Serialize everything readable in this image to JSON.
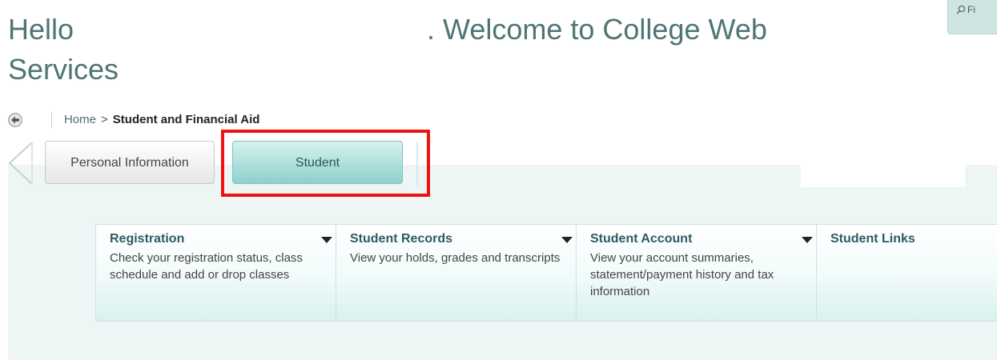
{
  "header": {
    "hello": "Hello",
    "welcome": ". Welcome to College Web",
    "services": "Services",
    "search_label": "Fi"
  },
  "breadcrumb": {
    "home": "Home",
    "separator": ">",
    "current": "Student and Financial Aid"
  },
  "tabs": [
    {
      "label": "Personal Information",
      "selected": false
    },
    {
      "label": "Student",
      "selected": true
    }
  ],
  "cards": [
    {
      "title": "Registration",
      "description": "Check your registration status, class schedule and add or drop classes",
      "has_menu": true
    },
    {
      "title": "Student Records",
      "description": "View your holds, grades and transcripts",
      "has_menu": true
    },
    {
      "title": "Student Account",
      "description": "View your account summaries, statement/payment history and tax information",
      "has_menu": true
    },
    {
      "title": "Student Links",
      "description": "",
      "has_menu": false
    }
  ],
  "colors": {
    "accent": "#4f7574",
    "selected_tab": "#8fd0cd",
    "highlight": "#ee1111",
    "panel_bg": "#eef5f5"
  }
}
